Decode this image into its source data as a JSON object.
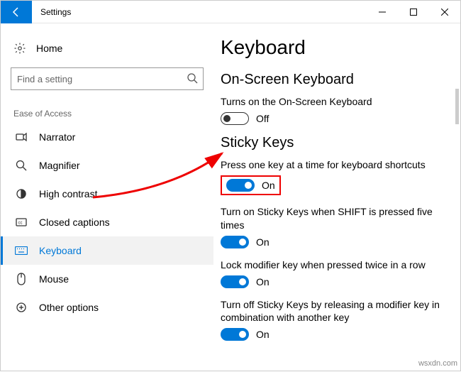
{
  "window": {
    "title": "Settings"
  },
  "sidebar": {
    "home": "Home",
    "search_placeholder": "Find a setting",
    "group_label": "Ease of Access",
    "items": [
      {
        "label": "Narrator"
      },
      {
        "label": "Magnifier"
      },
      {
        "label": "High contrast"
      },
      {
        "label": "Closed captions"
      },
      {
        "label": "Keyboard"
      },
      {
        "label": "Mouse"
      },
      {
        "label": "Other options"
      }
    ]
  },
  "content": {
    "heading": "Keyboard",
    "sections": [
      {
        "title": "On-Screen Keyboard",
        "settings": [
          {
            "label": "Turns on the On-Screen Keyboard",
            "state": "Off",
            "on": false
          }
        ]
      },
      {
        "title": "Sticky Keys",
        "settings": [
          {
            "label": "Press one key at a time for keyboard shortcuts",
            "state": "On",
            "on": true,
            "highlighted": true
          },
          {
            "label": "Turn on Sticky Keys when SHIFT is pressed five times",
            "state": "On",
            "on": true
          },
          {
            "label": "Lock modifier key when pressed twice in a row",
            "state": "On",
            "on": true
          },
          {
            "label": "Turn off Sticky Keys by releasing a modifier key in combination with another key",
            "state": "On",
            "on": true
          }
        ]
      }
    ]
  },
  "watermark": "wsxdn.com",
  "annotation": {
    "color": "#e00"
  }
}
